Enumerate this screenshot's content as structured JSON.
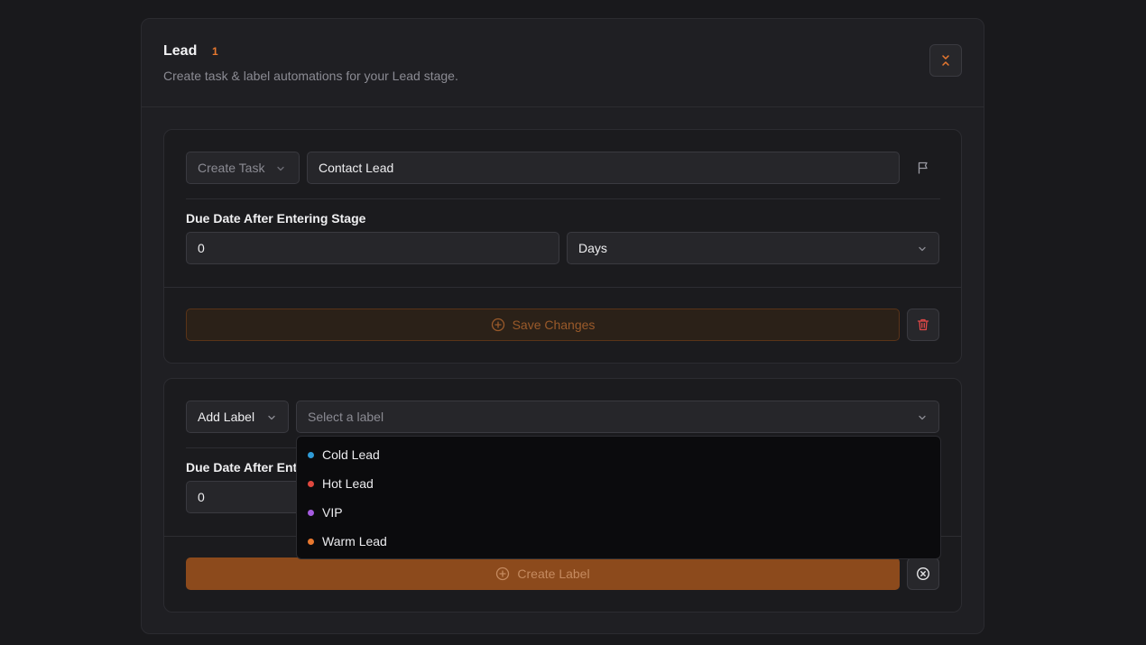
{
  "stage": {
    "title": "Lead",
    "count": "1",
    "description": "Create task & label automations for your Lead stage."
  },
  "task_panel": {
    "action_select": "Create Task",
    "task_name": "Contact Lead",
    "due_label": "Due Date After Entering Stage",
    "due_value": "0",
    "unit_select": "Days",
    "save_label": "Save Changes"
  },
  "label_panel": {
    "action_select": "Add Label",
    "label_placeholder": "Select a label",
    "due_label_partial": "Due Date After Ent",
    "due_value": "0",
    "create_label": "Create Label"
  },
  "label_options": [
    {
      "name": "Cold Lead",
      "color": "#2f9bd6"
    },
    {
      "name": "Hot Lead",
      "color": "#e0483f"
    },
    {
      "name": "VIP",
      "color": "#a55be0"
    },
    {
      "name": "Warm Lead",
      "color": "#e8782f"
    }
  ],
  "colors": {
    "accent": "#e8782f",
    "danger": "#e04848",
    "background": "#19191c"
  }
}
